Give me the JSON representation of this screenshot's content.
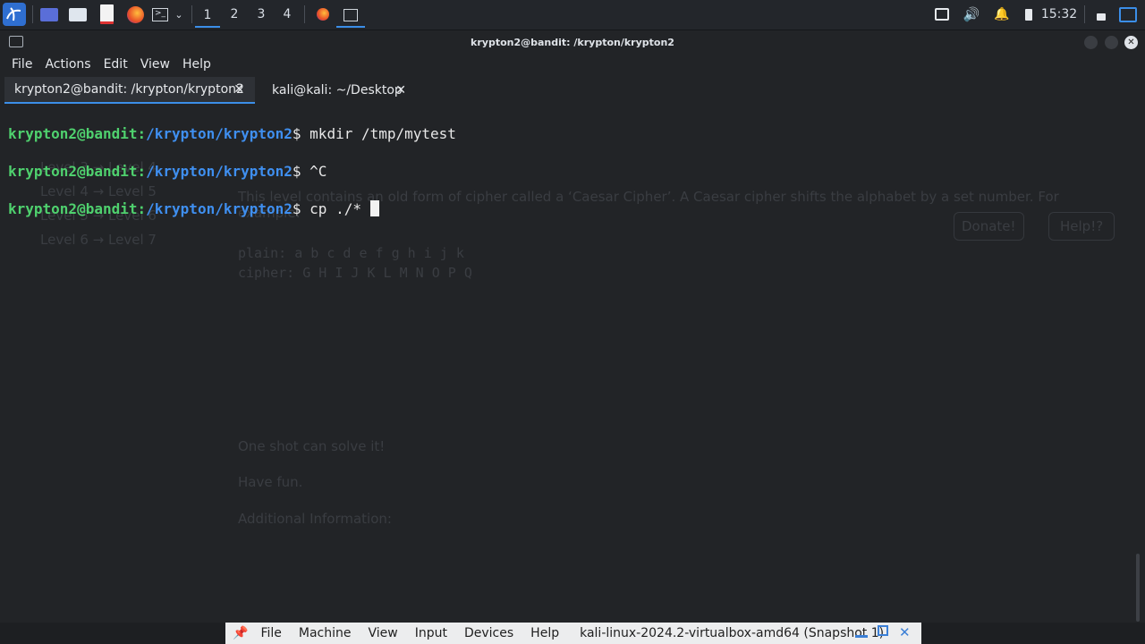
{
  "panel": {
    "workspaces": [
      "1",
      "2",
      "3",
      "4"
    ],
    "clock": "15:32"
  },
  "window": {
    "title": "krypton2@bandit: /krypton/krypton2",
    "menu": [
      "File",
      "Actions",
      "Edit",
      "View",
      "Help"
    ],
    "tabs": [
      {
        "label": "krypton2@bandit: /krypton/krypton2",
        "close": "✕"
      },
      {
        "label": "kali@kali: ~/Desktop",
        "close": "✕"
      }
    ]
  },
  "terminal": {
    "user_host": "krypton2@bandit",
    "path": "/krypton/krypton2",
    "lines": [
      {
        "command": "mkdir /tmp/mytest"
      },
      {
        "command": "^C"
      },
      {
        "command": "cp ./* "
      }
    ]
  },
  "background_page": {
    "sidebar": [
      "Level 3 → Level 4",
      "Level 4 → Level 5",
      "Level 5 → Level 6",
      "Level 6 → Level 7"
    ],
    "buttons": [
      "Donate!",
      "Help!?"
    ],
    "paragraphs": [
      "This level contains an old form of cipher called a ‘Caesar Cipher’. A Caesar cipher shifts the alphabet by a set number. For example:",
      "plain:  a b c d e f g h i j k",
      "cipher: G H I J K L M N O P Q",
      "One shot can solve it!",
      "Have fun.",
      "Additional Information:"
    ]
  },
  "vbox": {
    "menu": [
      "File",
      "Machine",
      "View",
      "Input",
      "Devices",
      "Help"
    ],
    "title": "kali-linux-2024.2-virtualbox-amd64 (Snapshot 1)"
  }
}
